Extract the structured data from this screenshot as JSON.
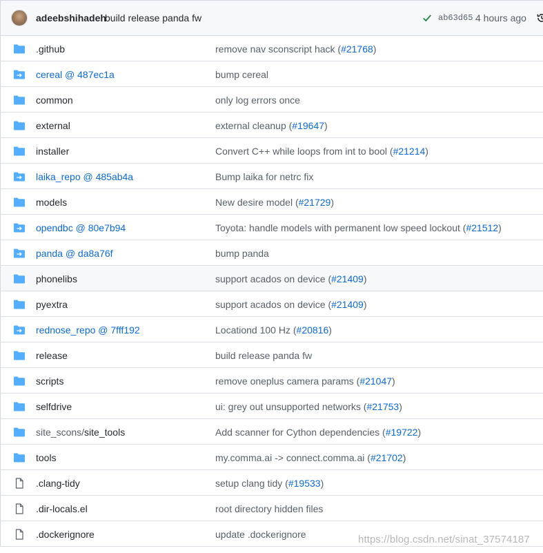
{
  "header": {
    "author": "adeebshihadeh",
    "message": "build release panda fw",
    "sha": "ab63d65",
    "time": "4 hours ago"
  },
  "files": [
    {
      "type": "dir",
      "name": "  .github",
      "message_prefix": "remove nav sconscript hack (",
      "pr": "#21768",
      "message_suffix": ")"
    },
    {
      "type": "submodule",
      "name": "cereal @ 487ec1a",
      "message_prefix": "bump cereal",
      "pr": "",
      "message_suffix": ""
    },
    {
      "type": "dir",
      "name": "common",
      "message_prefix": "only log errors once",
      "pr": "",
      "message_suffix": ""
    },
    {
      "type": "dir",
      "name": "external",
      "message_prefix": "external cleanup (",
      "pr": "#19647",
      "message_suffix": ")"
    },
    {
      "type": "dir",
      "name": "installer",
      "message_prefix": "Convert C++ while loops from int to bool (",
      "pr": "#21214",
      "message_suffix": ")"
    },
    {
      "type": "submodule",
      "name": "laika_repo @ 485ab4a",
      "message_prefix": "Bump laika for netrc fix",
      "pr": "",
      "message_suffix": ""
    },
    {
      "type": "dir",
      "name": "models",
      "message_prefix": "New desire model (",
      "pr": "#21729",
      "message_suffix": ")"
    },
    {
      "type": "submodule",
      "name": "opendbc @ 80e7b94",
      "message_prefix": "Toyota: handle models with permanent low speed lockout (",
      "pr": "#21512",
      "message_suffix": ")"
    },
    {
      "type": "submodule",
      "name": "panda @ da8a76f",
      "message_prefix": "bump panda",
      "pr": "",
      "message_suffix": ""
    },
    {
      "type": "dir",
      "name": "phonelibs",
      "message_prefix": "support acados on device (",
      "pr": "#21409",
      "message_suffix": ")"
    },
    {
      "type": "dir",
      "name": "pyextra",
      "message_prefix": "support acados on device (",
      "pr": "#21409",
      "message_suffix": ")"
    },
    {
      "type": "submodule",
      "name": "rednose_repo @ 7fff192",
      "message_prefix": "Locationd 100 Hz (",
      "pr": "#20816",
      "message_suffix": ")"
    },
    {
      "type": "dir",
      "name": "release",
      "message_prefix": "build release panda fw",
      "pr": "",
      "message_suffix": ""
    },
    {
      "type": "dir",
      "name": "scripts",
      "message_prefix": "remove oneplus camera params (",
      "pr": "#21047",
      "message_suffix": ")"
    },
    {
      "type": "dir",
      "name": "selfdrive",
      "message_prefix": "ui: grey out unsupported networks (",
      "pr": "#21753",
      "message_suffix": ")"
    },
    {
      "type": "dir",
      "name": "site_scons/site_tools",
      "name_muted": "site_scons/",
      "name_main": "site_tools",
      "message_prefix": "Add scanner for Cython dependencies (",
      "pr": "#19722",
      "message_suffix": ")"
    },
    {
      "type": "dir",
      "name": "tools",
      "message_prefix": "my.comma.ai -> connect.comma.ai (",
      "pr": "#21702",
      "message_suffix": ")"
    },
    {
      "type": "file",
      "name": ".clang-tidy",
      "message_prefix": "setup clang tidy (",
      "pr": "#19533",
      "message_suffix": ")"
    },
    {
      "type": "file",
      "name": ".dir-locals.el",
      "message_prefix": "root directory hidden files",
      "pr": "",
      "message_suffix": ""
    },
    {
      "type": "file",
      "name": ".dockerignore",
      "message_prefix": "update .dockerignore",
      "pr": "",
      "message_suffix": ""
    }
  ],
  "watermark": "https://blog.csdn.net/sinat_37574187",
  "colors": {
    "folder": "#54aeff",
    "link": "#0969da",
    "check": "#1a7f37"
  }
}
